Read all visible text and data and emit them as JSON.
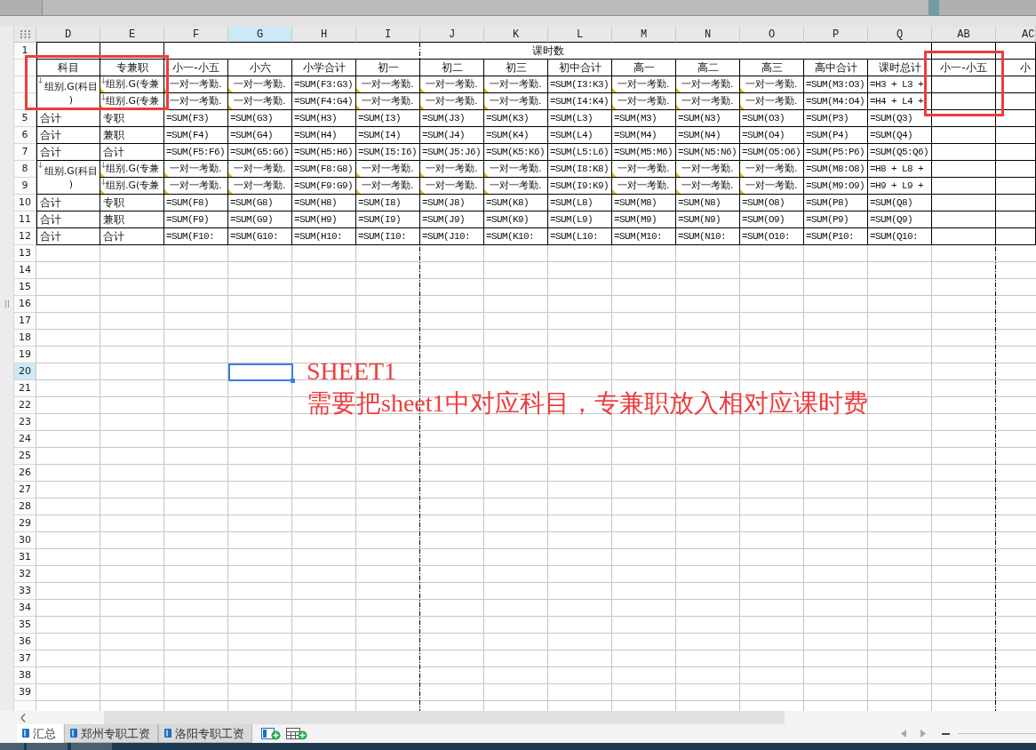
{
  "sheet": {
    "columns": [
      {
        "label": "D",
        "selected": false
      },
      {
        "label": "E",
        "selected": false
      },
      {
        "label": "F",
        "selected": false
      },
      {
        "label": "G",
        "selected": true
      },
      {
        "label": "H",
        "selected": false
      },
      {
        "label": "I",
        "selected": false
      },
      {
        "label": "J",
        "selected": false
      },
      {
        "label": "K",
        "selected": false
      },
      {
        "label": "L",
        "selected": false
      },
      {
        "label": "M",
        "selected": false
      },
      {
        "label": "N",
        "selected": false
      },
      {
        "label": "O",
        "selected": false
      },
      {
        "label": "P",
        "selected": false
      },
      {
        "label": "Q",
        "selected": false
      },
      {
        "label": "AB",
        "selected": false
      },
      {
        "label": "AC",
        "selected": false
      }
    ],
    "row_numbers": [
      {
        "label": "1",
        "selected": false
      },
      {
        "selected": false
      },
      {
        "selected": false
      },
      {
        "selected": false
      },
      {
        "label": "5",
        "selected": false
      },
      {
        "label": "6",
        "selected": false
      },
      {
        "label": "7",
        "selected": false
      },
      {
        "label": "8",
        "selected": false
      },
      {
        "label": "9",
        "selected": false
      },
      {
        "label": "10",
        "selected": false
      },
      {
        "label": "11",
        "selected": false
      },
      {
        "label": "12",
        "selected": false
      },
      {
        "label": "13",
        "selected": false
      },
      {
        "label": "14",
        "selected": false
      },
      {
        "label": "15",
        "selected": false
      },
      {
        "label": "16",
        "selected": false
      },
      {
        "label": "17",
        "selected": false
      },
      {
        "label": "18",
        "selected": false
      },
      {
        "label": "19",
        "selected": false
      },
      {
        "label": "20",
        "selected": true
      },
      {
        "label": "21",
        "selected": false
      },
      {
        "label": "22",
        "selected": false
      },
      {
        "label": "23",
        "selected": false
      },
      {
        "label": "24",
        "selected": false
      },
      {
        "label": "25",
        "selected": false
      },
      {
        "label": "26",
        "selected": false
      },
      {
        "label": "27",
        "selected": false
      },
      {
        "label": "28",
        "selected": false
      },
      {
        "label": "29",
        "selected": false
      },
      {
        "label": "30",
        "selected": false
      },
      {
        "label": "31",
        "selected": false
      },
      {
        "label": "32",
        "selected": false
      },
      {
        "label": "33",
        "selected": false
      },
      {
        "label": "34",
        "selected": false
      },
      {
        "label": "35",
        "selected": false
      },
      {
        "label": "36",
        "selected": false
      },
      {
        "label": "37",
        "selected": false
      },
      {
        "label": "38",
        "selected": false
      },
      {
        "label": "39",
        "selected": false
      }
    ],
    "title": "课时数",
    "leading_headers": [
      "科目",
      "专兼职"
    ],
    "hour_headers": [
      "小一-小五",
      "小六",
      "小学合计",
      "初一",
      "初二",
      "初三",
      "初中合计",
      "高一",
      "高二",
      "高三",
      "高中合计",
      "课时总计"
    ],
    "trailing_headers": [
      "小一-小五",
      "小"
    ],
    "blocks": [
      {
        "kind": "group",
        "subject": {
          "text": "组别.G(科目)",
          "kind": "group"
        },
        "lines": [
          [
            {
              "text": "组别.G(专兼",
              "kind": "field"
            },
            {
              "text": "一对一考勤.",
              "kind": "data"
            },
            {
              "text": "一对一考勤.",
              "kind": "data"
            },
            {
              "text": "=SUM(F3:G3)",
              "kind": "formula"
            },
            {
              "text": "一对一考勤.",
              "kind": "data"
            },
            {
              "text": "一对一考勤.",
              "kind": "data"
            },
            {
              "text": "一对一考勤.",
              "kind": "data"
            },
            {
              "text": "=SUM(I3:K3)",
              "kind": "formula"
            },
            {
              "text": "一对一考勤.",
              "kind": "data"
            },
            {
              "text": "一对一考勤.",
              "kind": "data"
            },
            {
              "text": "一对一考勤.",
              "kind": "data"
            },
            {
              "text": "=SUM(M3:O3)",
              "kind": "formula"
            },
            {
              "text": "=H3 + L3 +",
              "kind": "formula"
            }
          ],
          [
            {
              "text": "组别.G(专兼",
              "kind": "field"
            },
            {
              "text": "一对一考勤.",
              "kind": "data"
            },
            {
              "text": "一对一考勤.",
              "kind": "data"
            },
            {
              "text": "=SUM(F4:G4)",
              "kind": "formula"
            },
            {
              "text": "一对一考勤.",
              "kind": "data"
            },
            {
              "text": "一对一考勤.",
              "kind": "data"
            },
            {
              "text": "一对一考勤.",
              "kind": "data"
            },
            {
              "text": "=SUM(I4:K4)",
              "kind": "formula"
            },
            {
              "text": "一对一考勤.",
              "kind": "data"
            },
            {
              "text": "一对一考勤.",
              "kind": "data"
            },
            {
              "text": "一对一考勤.",
              "kind": "data"
            },
            {
              "text": "=SUM(M4:O4)",
              "kind": "formula"
            },
            {
              "text": "=H4 + L4 +",
              "kind": "formula"
            }
          ]
        ]
      },
      {
        "kind": "totals",
        "lines": [
          [
            {
              "text": "合计",
              "kind": "text"
            },
            {
              "text": "专职",
              "kind": "text"
            },
            {
              "text": "=SUM(F3)",
              "kind": "formula"
            },
            {
              "text": "=SUM(G3)",
              "kind": "formula"
            },
            {
              "text": "=SUM(H3)",
              "kind": "formula"
            },
            {
              "text": "=SUM(I3)",
              "kind": "formula"
            },
            {
              "text": "=SUM(J3)",
              "kind": "formula"
            },
            {
              "text": "=SUM(K3)",
              "kind": "formula"
            },
            {
              "text": "=SUM(L3)",
              "kind": "formula"
            },
            {
              "text": "=SUM(M3)",
              "kind": "formula"
            },
            {
              "text": "=SUM(N3)",
              "kind": "formula"
            },
            {
              "text": "=SUM(O3)",
              "kind": "formula"
            },
            {
              "text": "=SUM(P3)",
              "kind": "formula"
            },
            {
              "text": "=SUM(Q3)",
              "kind": "formula"
            }
          ],
          [
            {
              "text": "合计",
              "kind": "text"
            },
            {
              "text": "兼职",
              "kind": "text"
            },
            {
              "text": "=SUM(F4)",
              "kind": "formula"
            },
            {
              "text": "=SUM(G4)",
              "kind": "formula"
            },
            {
              "text": "=SUM(H4)",
              "kind": "formula"
            },
            {
              "text": "=SUM(I4)",
              "kind": "formula"
            },
            {
              "text": "=SUM(J4)",
              "kind": "formula"
            },
            {
              "text": "=SUM(K4)",
              "kind": "formula"
            },
            {
              "text": "=SUM(L4)",
              "kind": "formula"
            },
            {
              "text": "=SUM(M4)",
              "kind": "formula"
            },
            {
              "text": "=SUM(N4)",
              "kind": "formula"
            },
            {
              "text": "=SUM(O4)",
              "kind": "formula"
            },
            {
              "text": "=SUM(P4)",
              "kind": "formula"
            },
            {
              "text": "=SUM(Q4)",
              "kind": "formula"
            }
          ],
          [
            {
              "text": "合计",
              "kind": "text"
            },
            {
              "text": "合计",
              "kind": "text"
            },
            {
              "text": "=SUM(F5:F6)",
              "kind": "formula"
            },
            {
              "text": "=SUM(G5:G6)",
              "kind": "formula"
            },
            {
              "text": "=SUM(H5:H6)",
              "kind": "formula"
            },
            {
              "text": "=SUM(I5:I6)",
              "kind": "formula"
            },
            {
              "text": "=SUM(J5:J6)",
              "kind": "formula"
            },
            {
              "text": "=SUM(K5:K6)",
              "kind": "formula"
            },
            {
              "text": "=SUM(L5:L6)",
              "kind": "formula"
            },
            {
              "text": "=SUM(M5:M6)",
              "kind": "formula"
            },
            {
              "text": "=SUM(N5:N6)",
              "kind": "formula"
            },
            {
              "text": "=SUM(O5:O6)",
              "kind": "formula"
            },
            {
              "text": "=SUM(P5:P6)",
              "kind": "formula"
            },
            {
              "text": "=SUM(Q5:Q6)",
              "kind": "formula"
            }
          ]
        ]
      },
      {
        "kind": "group",
        "subject": {
          "text": "组别.G(科目)",
          "kind": "group"
        },
        "lines": [
          [
            {
              "text": "组别.G(专兼",
              "kind": "field"
            },
            {
              "text": "一对一考勤.",
              "kind": "data"
            },
            {
              "text": "一对一考勤.",
              "kind": "data"
            },
            {
              "text": "=SUM(F8:G8)",
              "kind": "formula"
            },
            {
              "text": "一对一考勤.",
              "kind": "data"
            },
            {
              "text": "一对一考勤.",
              "kind": "data"
            },
            {
              "text": "一对一考勤.",
              "kind": "data"
            },
            {
              "text": "=SUM(I8:K8)",
              "kind": "formula"
            },
            {
              "text": "一对一考勤.",
              "kind": "data"
            },
            {
              "text": "一对一考勤.",
              "kind": "data"
            },
            {
              "text": "一对一考勤.",
              "kind": "data"
            },
            {
              "text": "=SUM(M8:O8)",
              "kind": "formula"
            },
            {
              "text": "=H8 + L8 +",
              "kind": "formula"
            }
          ],
          [
            {
              "text": "组别.G(专兼",
              "kind": "field"
            },
            {
              "text": "一对一考勤.",
              "kind": "data"
            },
            {
              "text": "一对一考勤.",
              "kind": "data"
            },
            {
              "text": "=SUM(F9:G9)",
              "kind": "formula"
            },
            {
              "text": "一对一考勤.",
              "kind": "data"
            },
            {
              "text": "一对一考勤.",
              "kind": "data"
            },
            {
              "text": "一对一考勤.",
              "kind": "data"
            },
            {
              "text": "=SUM(I9:K9)",
              "kind": "formula"
            },
            {
              "text": "一对一考勤.",
              "kind": "data"
            },
            {
              "text": "一对一考勤.",
              "kind": "data"
            },
            {
              "text": "一对一考勤.",
              "kind": "data"
            },
            {
              "text": "=SUM(M9:O9)",
              "kind": "formula"
            },
            {
              "text": "=H9 + L9 +",
              "kind": "formula"
            }
          ]
        ]
      },
      {
        "kind": "totals",
        "lines": [
          [
            {
              "text": "合计",
              "kind": "text"
            },
            {
              "text": "专职",
              "kind": "text"
            },
            {
              "text": "=SUM(F8)",
              "kind": "formula"
            },
            {
              "text": "=SUM(G8)",
              "kind": "formula"
            },
            {
              "text": "=SUM(H8)",
              "kind": "formula"
            },
            {
              "text": "=SUM(I8)",
              "kind": "formula"
            },
            {
              "text": "=SUM(J8)",
              "kind": "formula"
            },
            {
              "text": "=SUM(K8)",
              "kind": "formula"
            },
            {
              "text": "=SUM(L8)",
              "kind": "formula"
            },
            {
              "text": "=SUM(M8)",
              "kind": "formula"
            },
            {
              "text": "=SUM(N8)",
              "kind": "formula"
            },
            {
              "text": "=SUM(O8)",
              "kind": "formula"
            },
            {
              "text": "=SUM(P8)",
              "kind": "formula"
            },
            {
              "text": "=SUM(Q8)",
              "kind": "formula"
            }
          ],
          [
            {
              "text": "合计",
              "kind": "text"
            },
            {
              "text": "兼职",
              "kind": "text"
            },
            {
              "text": "=SUM(F9)",
              "kind": "formula"
            },
            {
              "text": "=SUM(G9)",
              "kind": "formula"
            },
            {
              "text": "=SUM(H9)",
              "kind": "formula"
            },
            {
              "text": "=SUM(I9)",
              "kind": "formula"
            },
            {
              "text": "=SUM(J9)",
              "kind": "formula"
            },
            {
              "text": "=SUM(K9)",
              "kind": "formula"
            },
            {
              "text": "=SUM(L9)",
              "kind": "formula"
            },
            {
              "text": "=SUM(M9)",
              "kind": "formula"
            },
            {
              "text": "=SUM(N9)",
              "kind": "formula"
            },
            {
              "text": "=SUM(O9)",
              "kind": "formula"
            },
            {
              "text": "=SUM(P9)",
              "kind": "formula"
            },
            {
              "text": "=SUM(Q9)",
              "kind": "formula"
            }
          ],
          [
            {
              "text": "合计",
              "kind": "text"
            },
            {
              "text": "合计",
              "kind": "text"
            },
            {
              "text": "=SUM(F10:",
              "kind": "formula"
            },
            {
              "text": "=SUM(G10:",
              "kind": "formula"
            },
            {
              "text": "=SUM(H10:",
              "kind": "formula"
            },
            {
              "text": "=SUM(I10:",
              "kind": "formula"
            },
            {
              "text": "=SUM(J10:",
              "kind": "formula"
            },
            {
              "text": "=SUM(K10:",
              "kind": "formula"
            },
            {
              "text": "=SUM(L10:",
              "kind": "formula"
            },
            {
              "text": "=SUM(M10:",
              "kind": "formula"
            },
            {
              "text": "=SUM(N10:",
              "kind": "formula"
            },
            {
              "text": "=SUM(O10:",
              "kind": "formula"
            },
            {
              "text": "=SUM(P10:",
              "kind": "formula"
            },
            {
              "text": "=SUM(Q10:",
              "kind": "formula"
            }
          ]
        ]
      }
    ]
  },
  "annotation": {
    "title": "SHEET1",
    "note": "需要把sheet1中对应科目，专兼职放入相对应课时费"
  },
  "sheet_tabs": [
    {
      "label": "汇总",
      "selected": true
    },
    {
      "label": "郑州专职工资",
      "selected": false
    },
    {
      "label": "洛阳专职工资",
      "selected": false
    }
  ]
}
